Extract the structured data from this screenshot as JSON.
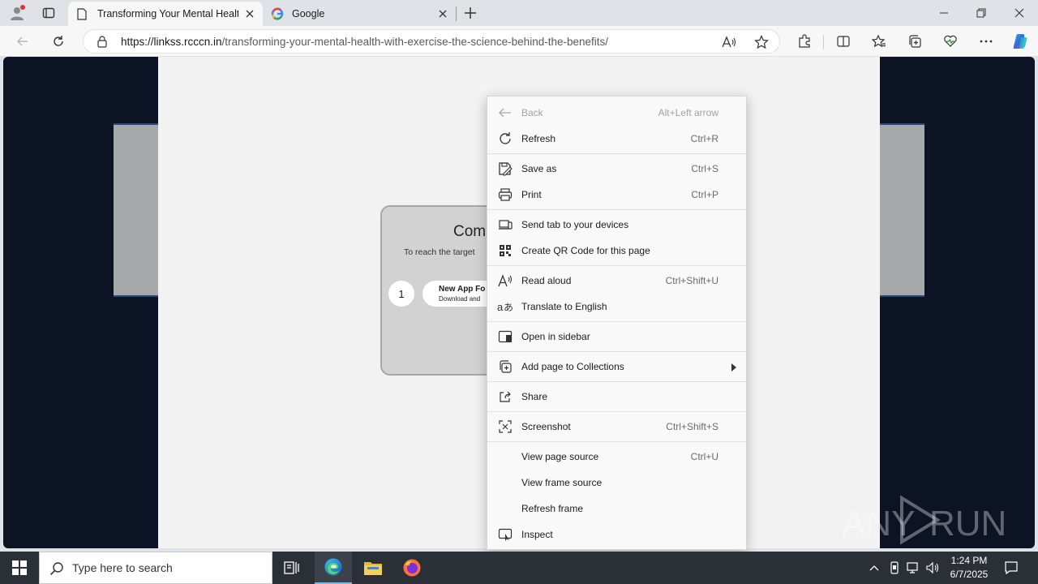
{
  "browser": {
    "tabs": [
      {
        "title": "Transforming Your Mental Health",
        "active": true
      },
      {
        "title": "Google",
        "active": false
      }
    ],
    "url_host": "https://linkss.rcccn.in",
    "url_path": "/transforming-your-mental-health-with-exercise-the-science-behind-the-benefits/"
  },
  "page": {
    "card_title": "Com",
    "card_subtitle": "To reach the target",
    "step_number": "1",
    "step_title": "New App Fo",
    "step_sub": "Download and"
  },
  "context_menu": {
    "items": [
      {
        "label": "Back",
        "shortcut": "Alt+Left arrow",
        "icon": "back-arrow-icon",
        "disabled": true
      },
      {
        "label": "Refresh",
        "shortcut": "Ctrl+R",
        "icon": "refresh-icon"
      },
      {
        "label": "Save as",
        "shortcut": "Ctrl+S",
        "icon": "save-as-icon"
      },
      {
        "label": "Print",
        "shortcut": "Ctrl+P",
        "icon": "printer-icon"
      },
      {
        "label": "Send tab to your devices",
        "shortcut": "",
        "icon": "devices-icon"
      },
      {
        "label": "Create QR Code for this page",
        "shortcut": "",
        "icon": "qr-code-icon"
      },
      {
        "label": "Read aloud",
        "shortcut": "Ctrl+Shift+U",
        "icon": "read-aloud-icon"
      },
      {
        "label": "Translate to English",
        "shortcut": "",
        "icon": "translate-icon"
      },
      {
        "label": "Open in sidebar",
        "shortcut": "",
        "icon": "sidebar-icon"
      },
      {
        "label": "Add page to Collections",
        "shortcut": "",
        "icon": "collections-icon",
        "submenu": true
      },
      {
        "label": "Share",
        "shortcut": "",
        "icon": "share-icon"
      },
      {
        "label": "Screenshot",
        "shortcut": "Ctrl+Shift+S",
        "icon": "screenshot-icon"
      },
      {
        "label": "View page source",
        "shortcut": "Ctrl+U",
        "icon": ""
      },
      {
        "label": "View frame source",
        "shortcut": "",
        "icon": ""
      },
      {
        "label": "Refresh frame",
        "shortcut": "",
        "icon": ""
      },
      {
        "label": "Inspect",
        "shortcut": "",
        "icon": "inspect-icon"
      }
    ]
  },
  "taskbar": {
    "search_placeholder": "Type here to search",
    "time": "1:24 PM",
    "date": "6/7/2025"
  },
  "watermark": {
    "text_left": "ANY",
    "text_right": "RUN"
  },
  "colors": {
    "page_background": "#0c1324",
    "accent": "#0f6cbd",
    "taskbar": "#2b2f36"
  }
}
